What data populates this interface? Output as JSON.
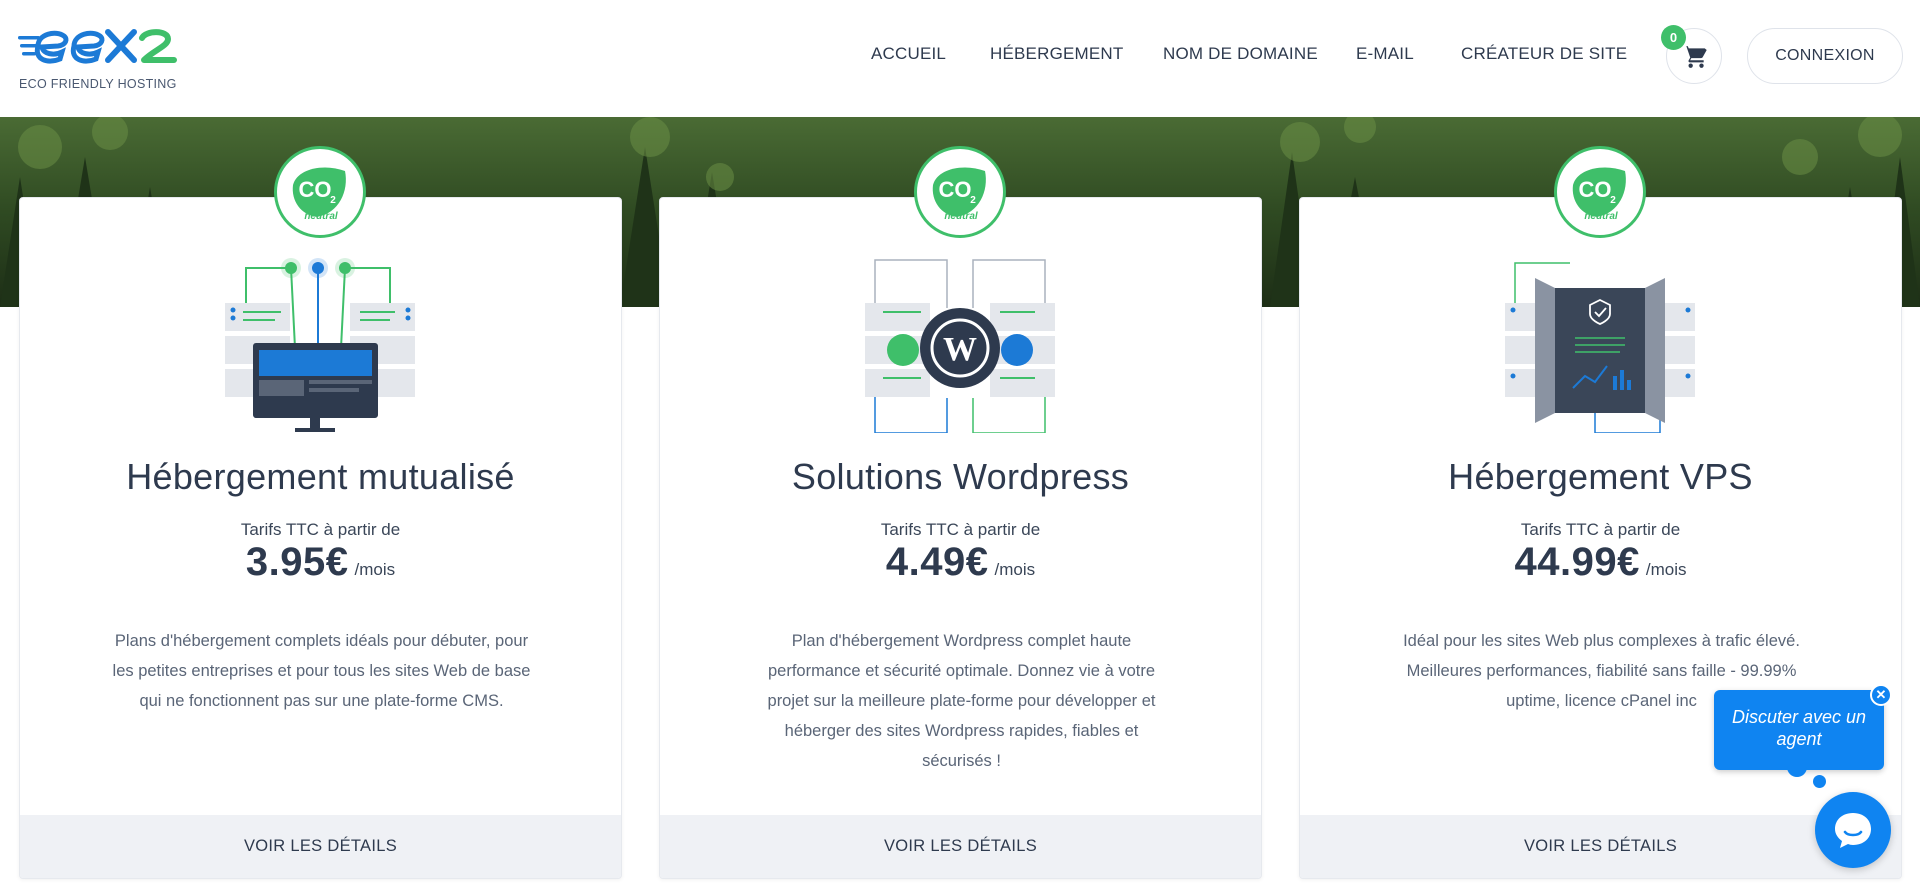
{
  "brand": {
    "name": "ex2",
    "tagline": "ECO FRIENDLY HOSTING",
    "colors": {
      "blue": "#1c7ad6",
      "green": "#3fbf6a",
      "text": "#2e3a4e"
    }
  },
  "nav": {
    "items": [
      {
        "label": "ACCUEIL"
      },
      {
        "label": "HÉBERGEMENT"
      },
      {
        "label": "NOM DE DOMAINE"
      },
      {
        "label": "E-MAIL"
      },
      {
        "label": "CRÉATEUR DE SITE"
      }
    ],
    "cart": {
      "icon": "cart-icon",
      "count": "0"
    },
    "login_label": "CONNEXION"
  },
  "badge": {
    "icon": "co2-neutral-icon",
    "text_top": "CO",
    "text_sub": "2",
    "text_bottom": "neutral"
  },
  "plans": [
    {
      "title": "Hébergement mutualisé",
      "price_label": "Tarifs TTC à partir de",
      "price": "3.95€",
      "per": "/mois",
      "description": "Plans d'hébergement complets idéals pour débuter, pour les petites entreprises et pour tous les sites Web de base qui ne fonctionnent pas sur une plate-forme CMS.",
      "cta": "VOIR LES DÉTAILS",
      "illustration": "shared-hosting-illustration"
    },
    {
      "title": "Solutions Wordpress",
      "price_label": "Tarifs TTC à partir de",
      "price": "4.49€",
      "per": "/mois",
      "description": "Plan d'hébergement Wordpress complet haute performance et sécurité optimale. Donnez vie à votre projet sur la meilleure plate-forme pour développer et héberger des sites Wordpress rapides, fiables et sécurisés !",
      "cta": "VOIR LES DÉTAILS",
      "illustration": "wordpress-illustration"
    },
    {
      "title": "Hébergement VPS",
      "price_label": "Tarifs TTC à partir de",
      "price": "44.99€",
      "per": "/mois",
      "description": "Idéal pour les sites Web plus complexes à trafic élevé. Meilleures performances, fiabilité sans faille - 99.99% uptime, licence cPanel inc",
      "cta": "VOIR LES DÉTAILS",
      "illustration": "vps-illustration"
    }
  ],
  "chat": {
    "prompt": "Discuter avec un agent",
    "close": "✕",
    "icon": "chat-icon"
  }
}
